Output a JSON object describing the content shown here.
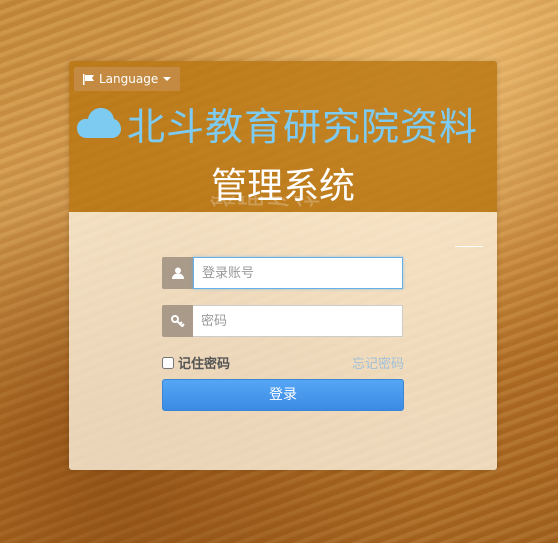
{
  "language_button": {
    "label": "Language",
    "icon": "flag-icon"
  },
  "title": {
    "line1": "北斗教育研究院资料",
    "line2": "管理系统",
    "logo_icon": "cloud-icon"
  },
  "form": {
    "username": {
      "placeholder": "登录账号",
      "icon": "user-icon"
    },
    "password": {
      "placeholder": "密码",
      "icon": "key-icon"
    },
    "remember_label": "记住密码",
    "forgot_label": "忘记密码",
    "submit_label": "登录"
  },
  "colors": {
    "title_accent": "#7ecbf2",
    "button_primary": "#3b8be4",
    "panel_header": "#ba7612"
  }
}
